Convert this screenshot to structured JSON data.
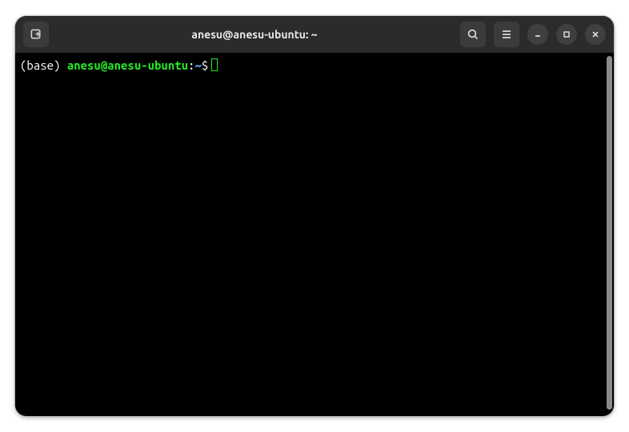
{
  "header": {
    "title": "anesu@anesu-ubuntu: ~"
  },
  "prompt": {
    "prefix_open": "(",
    "env": "base",
    "prefix_close": ") ",
    "userhost": "anesu@anesu-ubuntu",
    "colon": ":",
    "path": "~",
    "symbol": "$"
  }
}
